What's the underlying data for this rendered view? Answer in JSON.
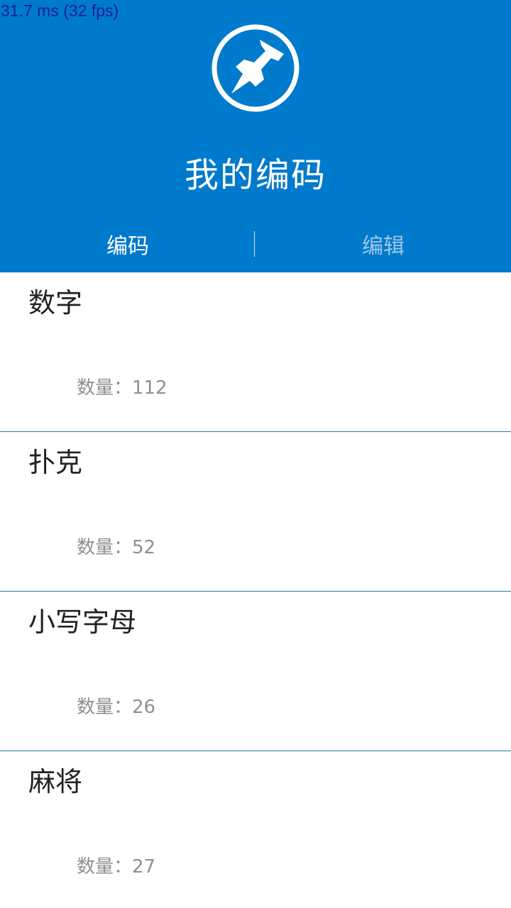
{
  "debug": {
    "fps_text": "31.7 ms (32 fps)"
  },
  "header": {
    "title": "我的编码",
    "logo_icon": "pushpin-icon",
    "background_color": "#007acc"
  },
  "tabs": [
    {
      "label": "编码",
      "active": true
    },
    {
      "label": "编辑",
      "active": false
    }
  ],
  "list": {
    "count_label": "数量：",
    "items": [
      {
        "name": "数字",
        "count": "112"
      },
      {
        "name": "扑克",
        "count": "52"
      },
      {
        "name": "小写字母",
        "count": "26"
      },
      {
        "name": "麻将",
        "count": "27"
      }
    ]
  }
}
